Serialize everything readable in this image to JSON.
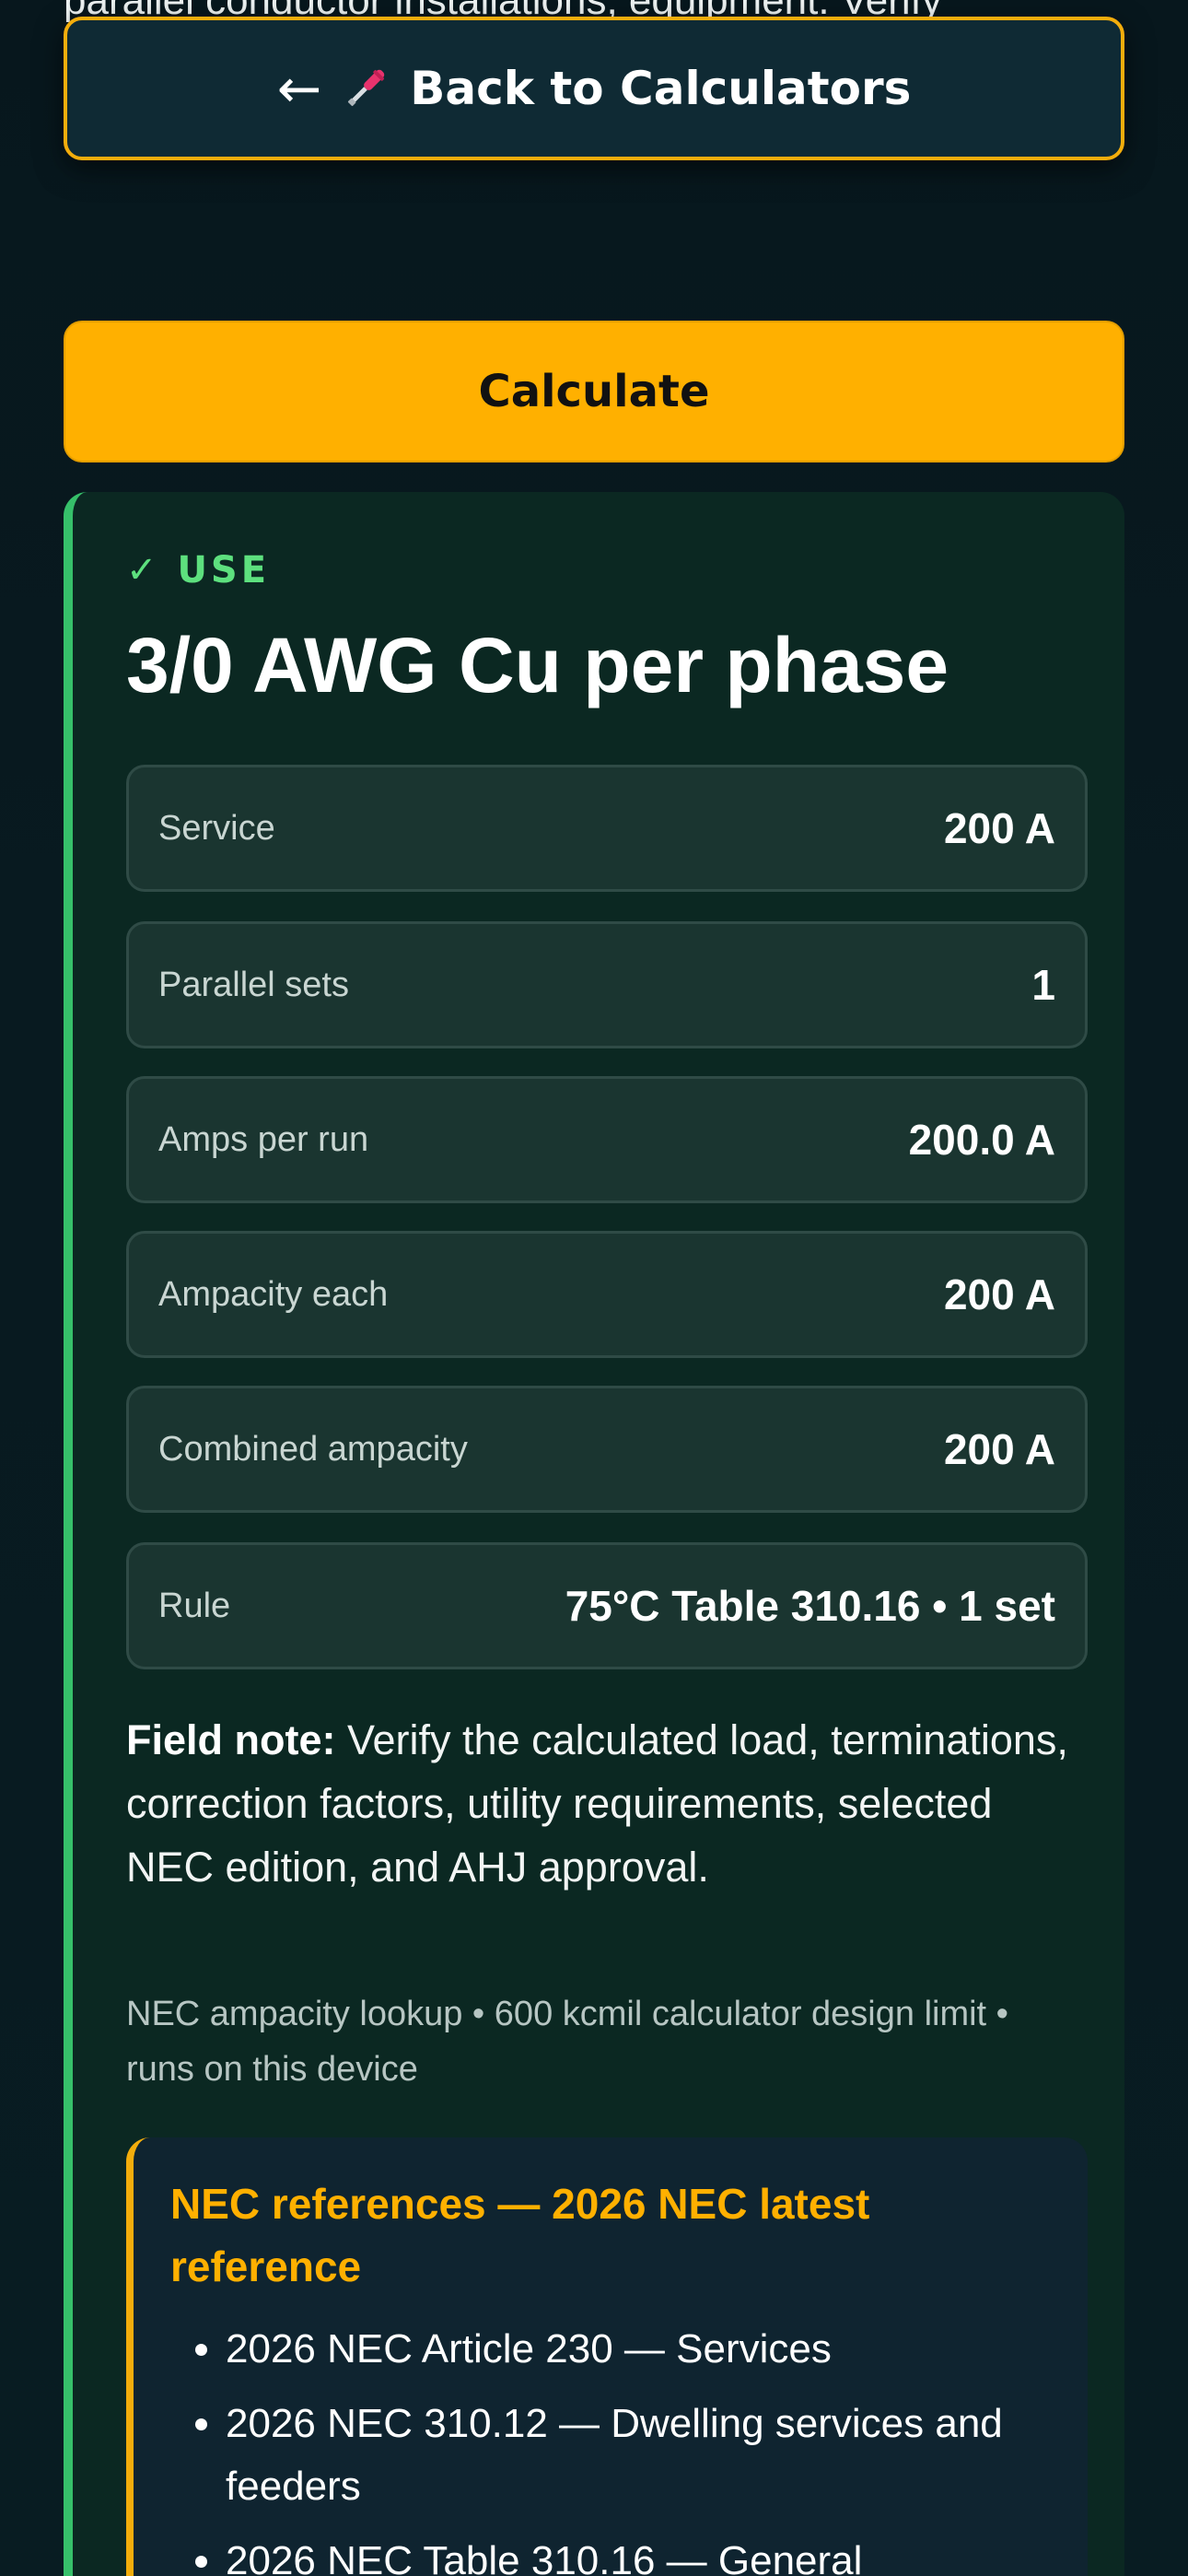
{
  "disclaimer": {
    "text": "parallel conductor installations, equipment. Verify equipment lugs, utility rules, adopted NEC edition, and AHJ."
  },
  "header": {
    "back_arrow": "←",
    "tool_icon": "screwdriver-icon",
    "back_label": "Back to Calculators"
  },
  "actions": {
    "calculate_label": "Calculate"
  },
  "result": {
    "status_check": "✓",
    "status_label": "USE",
    "title": "3/0 AWG Cu per phase",
    "rows": [
      {
        "label": "Service",
        "value": "200 A"
      },
      {
        "label": "Parallel sets",
        "value": "1"
      },
      {
        "label": "Amps per run",
        "value": "200.0 A"
      },
      {
        "label": "Ampacity each",
        "value": "200 A"
      },
      {
        "label": "Combined ampacity",
        "value": "200 A"
      },
      {
        "label": "Rule",
        "value": "75°C Table 310.16 • 1 set"
      }
    ],
    "field_note_label": "Field note:",
    "field_note_text": " Verify the calculated load, terminations, correction factors, utility requirements, selected NEC edition, and AHJ approval.",
    "meta": "NEC ampacity lookup • 600 kcmil calculator design limit • runs on this device"
  },
  "references": {
    "title": "NEC references — 2026 NEC latest reference",
    "items": [
      "2026 NEC Article 230 — Services",
      "2026 NEC 310.12 — Dwelling services and feeders",
      "2026 NEC Table 310.16 — General"
    ]
  },
  "colors": {
    "accent": "#ffb000",
    "success": "#36c06a",
    "background": "#07171d"
  }
}
